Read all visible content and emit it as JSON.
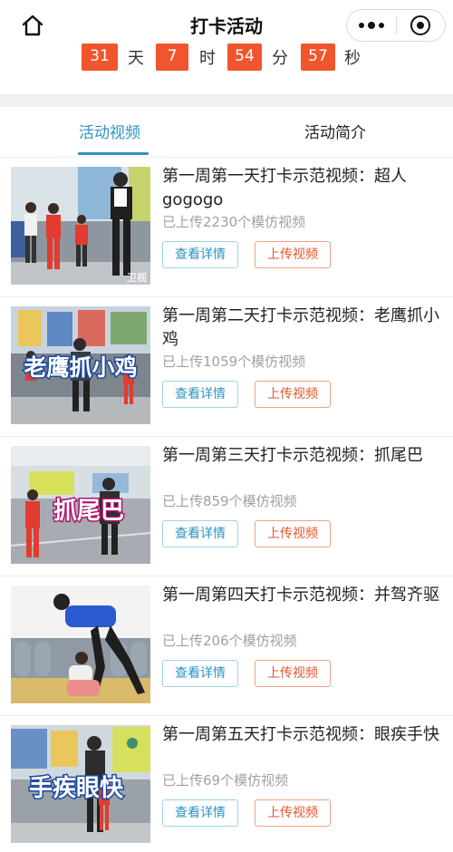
{
  "header": {
    "title": "打卡活动",
    "icons": {
      "home": "home-icon",
      "more": "more-dots-icon",
      "close": "close-target-icon"
    }
  },
  "countdown": {
    "days": "31",
    "days_unit": "天",
    "hours": "7",
    "hours_unit": "时",
    "minutes": "54",
    "minutes_unit": "分",
    "seconds": "57",
    "seconds_unit": "秒"
  },
  "tabs": [
    {
      "label": "活动视频",
      "active": true
    },
    {
      "label": "活动简介",
      "active": false
    }
  ],
  "colors": {
    "accent": "#2d93c5",
    "countdown": "#f0552d",
    "upload": "#e8552a"
  },
  "videos": [
    {
      "title": "第一周第一天打卡示范视频：超人gogogo",
      "uploaded": "已上传2230个模仿视频",
      "detail_label": "查看详情",
      "upload_label": "上传视频",
      "thumb_caption": "",
      "thumb_watermark": "卫视"
    },
    {
      "title": "第一周第二天打卡示范视频：老鹰抓小鸡",
      "uploaded": "已上传1059个模仿视频",
      "detail_label": "查看详情",
      "upload_label": "上传视频",
      "thumb_caption": "老鹰抓小鸡",
      "thumb_watermark": ""
    },
    {
      "title": "第一周第三天打卡示范视频：抓尾巴",
      "uploaded": "已上传859个模仿视频",
      "detail_label": "查看详情",
      "upload_label": "上传视频",
      "thumb_caption": "抓尾巴",
      "thumb_watermark": ""
    },
    {
      "title": "第一周第四天打卡示范视频：并驾齐驱",
      "uploaded": "已上传206个模仿视频",
      "detail_label": "查看详情",
      "upload_label": "上传视频",
      "thumb_caption": "",
      "thumb_watermark": ""
    },
    {
      "title": "第一周第五天打卡示范视频：眼疾手快",
      "uploaded": "已上传69个模仿视频",
      "detail_label": "查看详情",
      "upload_label": "上传视频",
      "thumb_caption": "手疾眼快",
      "thumb_watermark": ""
    }
  ]
}
